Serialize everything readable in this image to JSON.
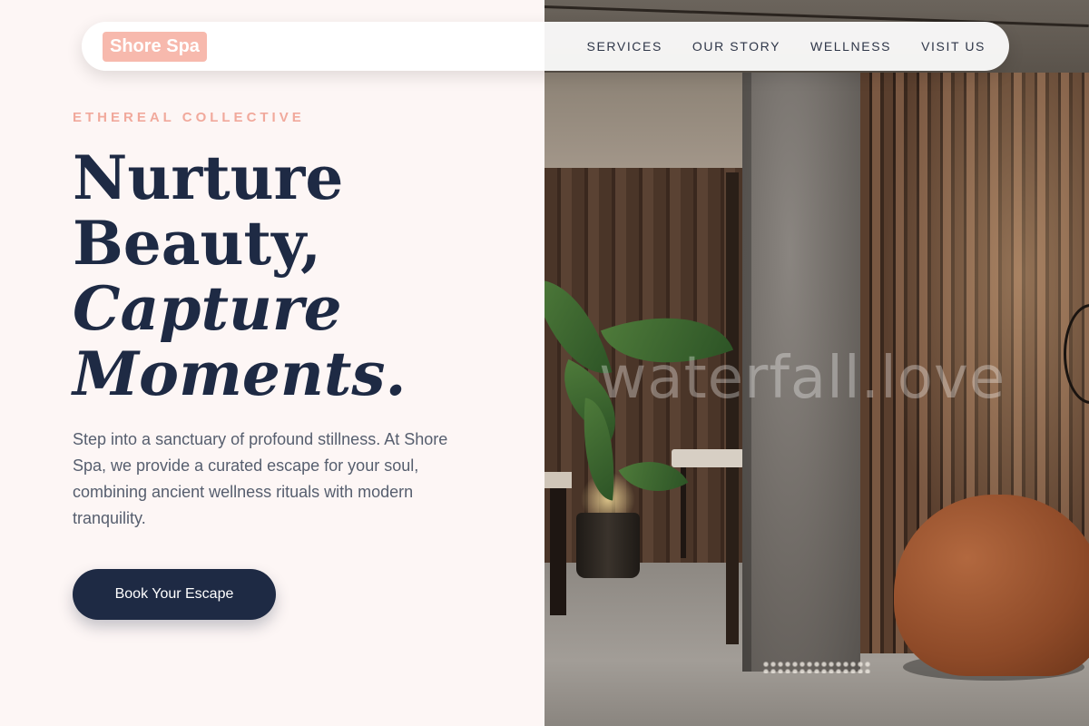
{
  "brand": {
    "name": "Shore Spa",
    "accent": "#f7b9ad",
    "dark": "#1e2a44"
  },
  "nav": {
    "links": [
      {
        "label": "SERVICES"
      },
      {
        "label": "OUR STORY"
      },
      {
        "label": "WELLNESS"
      },
      {
        "label": "VISIT US"
      }
    ]
  },
  "hero": {
    "eyebrow": "ETHEREAL COLLECTIVE",
    "headline": {
      "line1": "Nurture",
      "line2": "Beauty,",
      "line3": "Capture",
      "line4": "Moments."
    },
    "description": "Step into a sanctuary of profound stillness. At Shore Spa, we provide a curated escape for your soul, combining ancient wellness rituals with modern tranquility.",
    "cta_label": "Book Your Escape"
  },
  "photo": {
    "watermark": "waterfall.love"
  }
}
